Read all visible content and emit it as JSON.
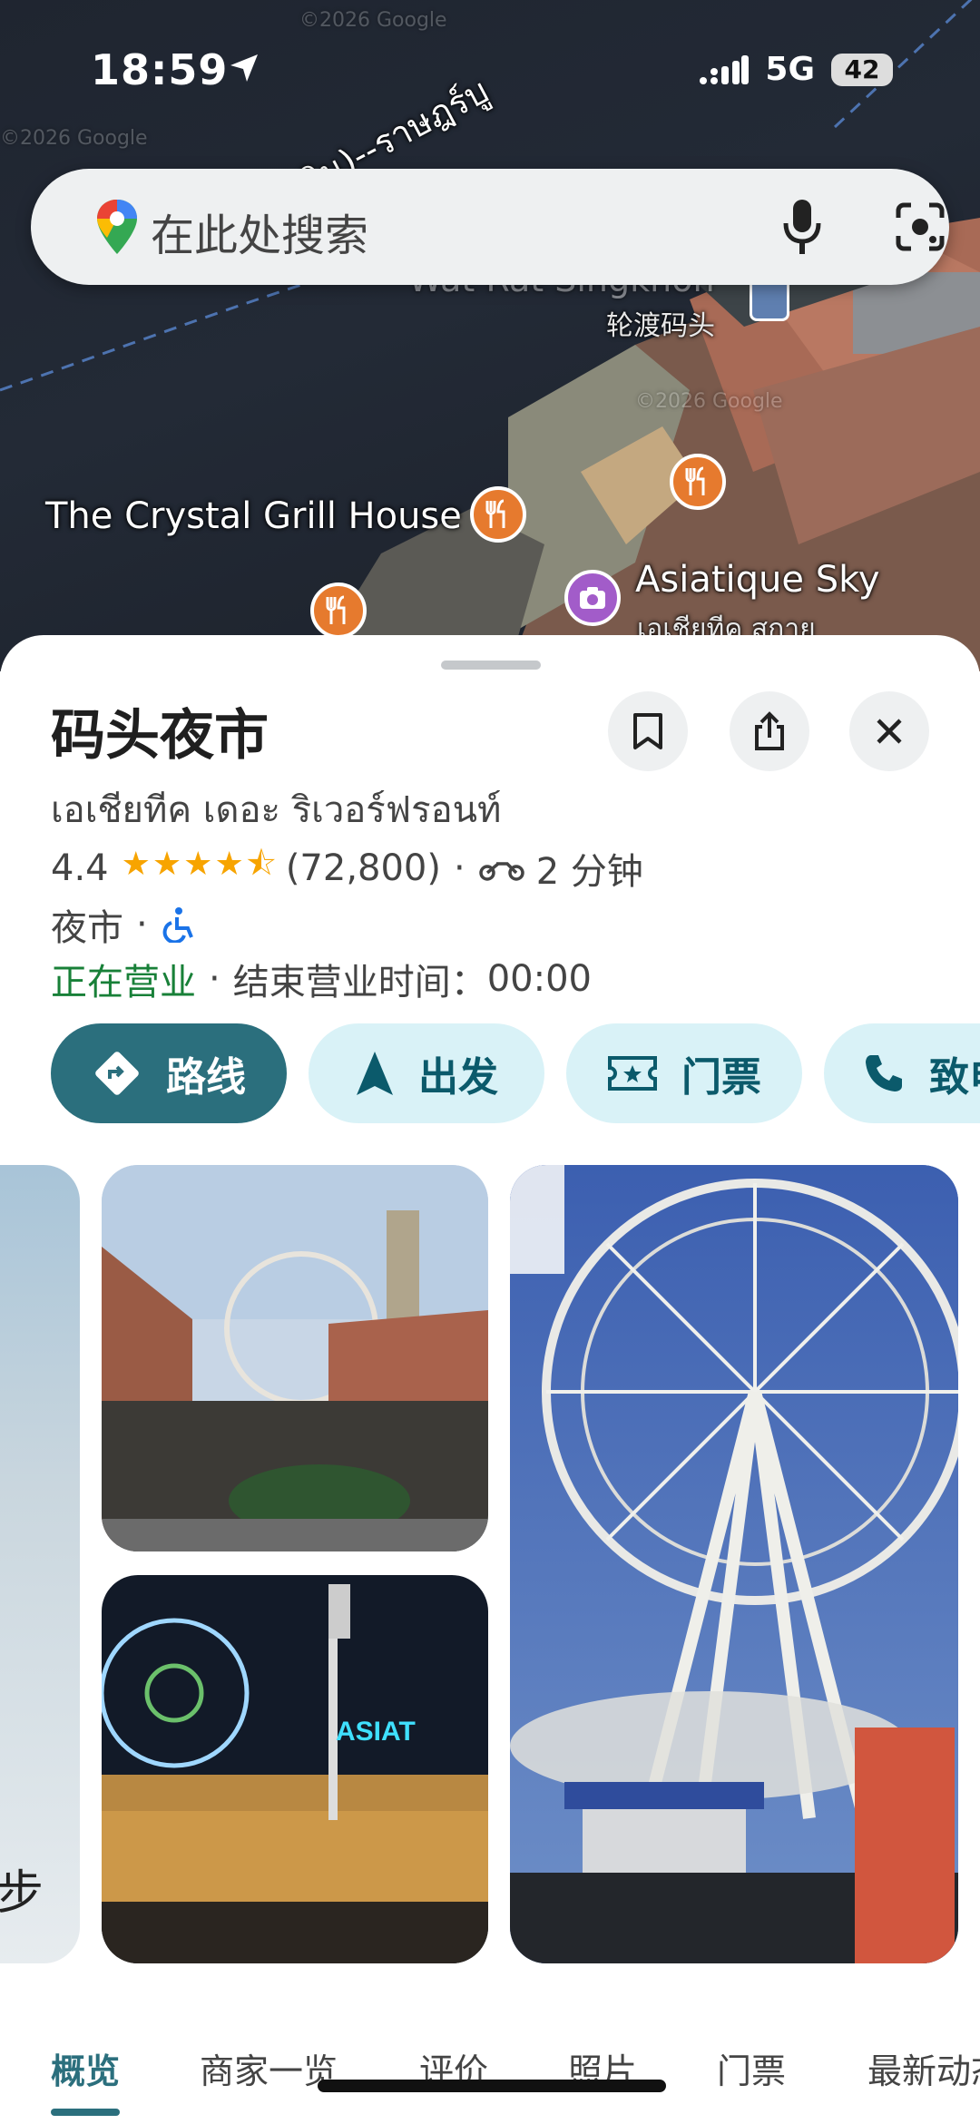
{
  "status_bar": {
    "time": "18:59",
    "network": "5G",
    "battery": "42"
  },
  "search": {
    "placeholder": "在此处搜索"
  },
  "map": {
    "labels": {
      "crystal_grill": "The Crystal Grill House",
      "ferry": "轮渡码头",
      "asiatique_sky": "Asiatique Sky",
      "asiatique_sky_thai": "เอเชียทีค สกาย",
      "road": "ลิน)--ราษฎร์บู",
      "watermark_top": "©2026 Google",
      "watermark_left": "©2026 Google",
      "watermark_mid": "©2026 Google",
      "faded_place": "Wat Rat Singkhon"
    }
  },
  "place": {
    "title": "码头夜市",
    "subtitle": "เอเชียทีค เดอะ ริเวอร์ฟรอนท์",
    "rating": "4.4",
    "rating_value": 4.4,
    "reviews": "(72,800)",
    "separator": "·",
    "travel_time": "2 分钟",
    "category": "夜市",
    "open_status": "正在营业",
    "hours_label": "结束营业时间：",
    "closing_time": "00:00"
  },
  "actions": {
    "directions": "路线",
    "start": "出发",
    "tickets": "门票",
    "call": "致电"
  },
  "photos": {
    "left_partial_text": "步"
  },
  "tabs": [
    "概览",
    "商家一览",
    "评价",
    "照片",
    "门票",
    "最新动态"
  ],
  "colors": {
    "accent": "#2b6f7d",
    "chip_bg": "#d9f2f7",
    "open_green": "#188038",
    "star": "#f7a400"
  }
}
